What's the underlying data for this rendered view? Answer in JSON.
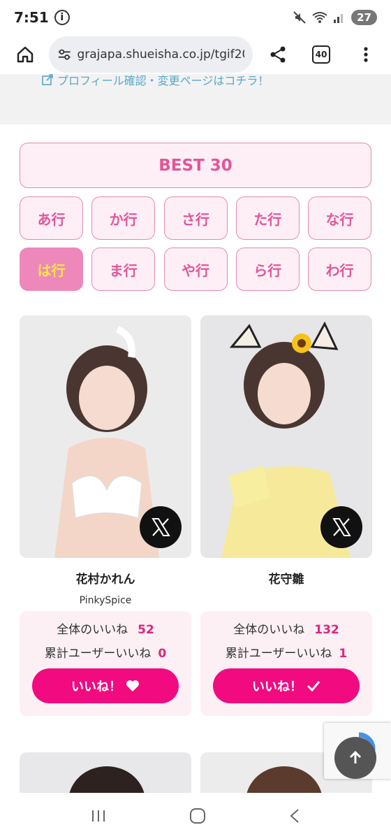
{
  "status": {
    "time": "7:51",
    "battery": "27"
  },
  "browser": {
    "url": "grajapa.shueisha.co.jp/tgif202",
    "tab_count": "40"
  },
  "profile_link": "プロフィール確認・変更ページはコチラ！",
  "filters": {
    "best": "BEST 30",
    "rows": [
      "あ行",
      "か行",
      "さ行",
      "た行",
      "な行",
      "は行",
      "ま行",
      "や行",
      "ら行",
      "わ行"
    ],
    "active": "は行"
  },
  "cards": [
    {
      "name": "花村かれん",
      "group": "PinkySpice",
      "total_likes_label": "全体のいいね",
      "total_likes": "52",
      "user_likes_label": "累計ユーザーいいね",
      "user_likes": "0",
      "button_label": "いいね！"
    },
    {
      "name": "花守雛",
      "group": "",
      "total_likes_label": "全体のいいね",
      "total_likes": "132",
      "user_likes_label": "累計ユーザーいいね",
      "user_likes": "1",
      "button_label": "いいね！"
    }
  ],
  "colors": {
    "accent": "#f20a80",
    "pink_text": "#e3559a",
    "active_bg": "#ee88bb",
    "active_text": "#ffe93c"
  }
}
